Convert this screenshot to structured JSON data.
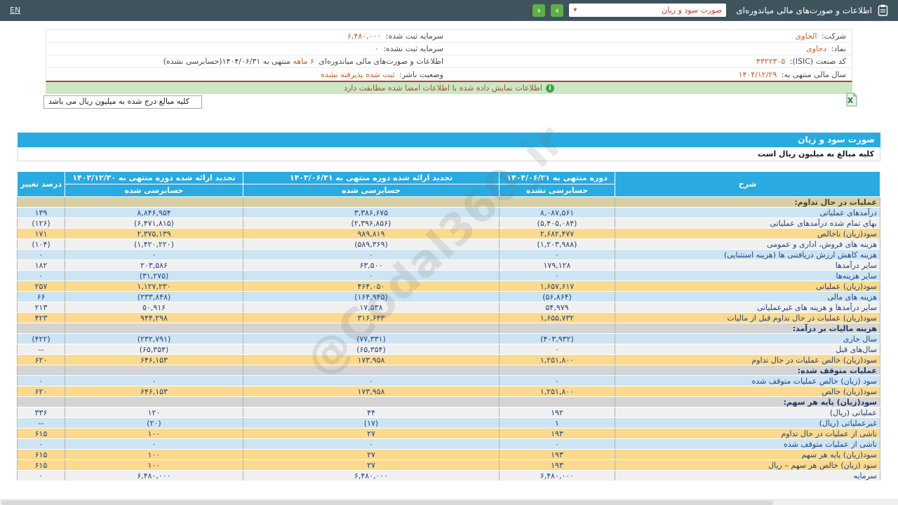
{
  "topbar": {
    "en_label": "EN",
    "title": "اطلاعات و صورت‌های مالی میاندوره‌ای",
    "dropdown_value": "صورت سود و زیان",
    "prev_icon": "‹",
    "next_icon": "›",
    "caret_icon": "▾"
  },
  "info_panel": {
    "rows": [
      {
        "right_label": "شرکت:",
        "right_value": "الحاوی",
        "left_label": "سرمایه ثبت شده:",
        "left_value": "۶,۴۸۰,۰۰۰"
      },
      {
        "right_label": "نماد:",
        "right_value": "دحاوی",
        "left_label": "سرمایه ثبت نشده:",
        "left_value": "۰"
      },
      {
        "right_label": "کد صنعت (ISIC):",
        "right_value": "۴۳۲۲۳۰۵",
        "left_prefix": "اطلاعات و صورت‌های مالی میاندوره‌ای ",
        "left_highlight": "۶ ماهه",
        "left_suffix": " منتهی به ۱۴۰۴/۰۶/۳۱(حسابرسی نشده)"
      },
      {
        "right_label": "سال مالی منتهی به:",
        "right_value": "۱۴۰۴/۱۲/۲۹",
        "left_label": "وضعیت ناشر:",
        "left_value": "ثبت شده پذیرفته نشده"
      }
    ]
  },
  "alert": {
    "icon": "i",
    "text": "اطلاعات نمایش داده شده با اطلاعات امضا شده مطابقت دارد"
  },
  "unit_box_text": "کلیه مبالغ درج شده به میلیون ریال می باشد",
  "statement": {
    "title": "صورت سود و زیان",
    "unit_note": "کلیه مبالغ به میلیون ریال است"
  },
  "table": {
    "header": {
      "desc": "شرح",
      "pct": "درصد تغییر",
      "cols": [
        {
          "period": "دوره منتهی به ۱۴۰۴/۰۶/۳۱",
          "audit": "حسابرسی نشده"
        },
        {
          "period": "تجدید ارائه شده دوره منتهی به ۱۴۰۳/۰۶/۳۱",
          "audit": "حسابرسی شده"
        },
        {
          "period": "تجدید ارائه شده دوره منتهی به ۱۴۰۳/۱۲/۳۰",
          "audit": "حسابرسی شده"
        }
      ]
    },
    "rows": [
      {
        "label": "عملیات در حال تداوم:",
        "v1": "",
        "v2": "",
        "v3": "",
        "pct": "",
        "style": "section-khaki"
      },
      {
        "label": "درآمدهای عملیاتی",
        "v1": "۸,۰۸۷,۵۶۱",
        "v2": "۳,۳۸۶,۶۷۵",
        "v3": "۸,۸۴۶,۹۵۴",
        "pct": "۱۳۹",
        "style": "blue"
      },
      {
        "label": "بهای تمام شده درآمدهای عملیاتی",
        "v1": "(۵,۴۰۵,۰۸۴)",
        "v2": "(۲,۳۹۶,۸۵۶)",
        "v3": "(۶,۴۷۱,۸۱۵)",
        "pct": "(۱۲۶)",
        "style": "white"
      },
      {
        "label": "سود(زیان) ناخالص",
        "v1": "۲,۶۸۲,۴۷۷",
        "v2": "۹۸۹,۸۱۹",
        "v3": "۲,۳۷۵,۱۳۹",
        "pct": "۱۷۱",
        "style": "yellow"
      },
      {
        "label": "هزینه های فروش، اداری و عمومی",
        "v1": "(۱,۲۰۳,۹۸۸)",
        "v2": "(۵۸۹,۳۶۹)",
        "v3": "(۱,۴۲۰,۲۲۰)",
        "pct": "(۱۰۴)",
        "style": "white"
      },
      {
        "label": "هزینه کاهش ارزش دریافتنی ها (هزینه استثنایی)",
        "v1": "۰",
        "v2": "۰",
        "v3": "۰",
        "pct": "۰",
        "style": "blue"
      },
      {
        "label": "سایر درآمدها",
        "v1": "۱۷۹,۱۲۸",
        "v2": "۶۳,۵۰۰",
        "v3": "۲۰۳,۵۸۶",
        "pct": "۱۸۲",
        "style": "white"
      },
      {
        "label": "سایر هزینه‌ها",
        "v1": "۰",
        "v2": "۰",
        "v3": "(۳۱,۲۷۵)",
        "pct": "۰",
        "style": "blue"
      },
      {
        "label": "سود(زیان) عملیاتی",
        "v1": "۱,۶۵۷,۶۱۷",
        "v2": "۴۶۴,۰۵۰",
        "v3": "۱,۱۲۷,۲۳۰",
        "pct": "۲۵۷",
        "style": "yellow"
      },
      {
        "label": "هزینه های مالی",
        "v1": "(۵۶,۸۶۴)",
        "v2": "(۱۶۴,۹۴۵)",
        "v3": "(۲۳۳,۸۴۸)",
        "pct": "۶۶",
        "style": "blue"
      },
      {
        "label": "سایر درآمدها و هزینه های غیرعملیاتی",
        "v1": "۵۴,۹۷۹",
        "v2": "۱۷,۵۳۸",
        "v3": "۵۰,۹۱۶",
        "pct": "۲۱۳",
        "style": "white"
      },
      {
        "label": "سود(زیان) عملیات در حال تداوم قبل از مالیات",
        "v1": "۱,۶۵۵,۷۳۲",
        "v2": "۳۱۶,۶۴۳",
        "v3": "۹۴۴,۲۹۸",
        "pct": "۴۲۳",
        "style": "yellow"
      },
      {
        "label": "هزینه مالیات بر درآمد:",
        "v1": "",
        "v2": "",
        "v3": "",
        "pct": "",
        "style": "section-gray"
      },
      {
        "label": "سال جاری",
        "v1": "(۴۰۳,۹۳۲)",
        "v2": "(۷۷,۳۳۱)",
        "v3": "(۲۳۲,۷۹۱)",
        "pct": "(۴۲۲)",
        "style": "blue"
      },
      {
        "label": "سال‌های قبل",
        "v1": "۰",
        "v2": "(۶۵,۳۵۴)",
        "v3": "(۶۵,۳۵۴)",
        "pct": "--",
        "style": "white"
      },
      {
        "label": "سود(زیان) خالص عملیات در حال تداوم",
        "v1": "۱,۲۵۱,۸۰۰",
        "v2": "۱۷۳,۹۵۸",
        "v3": "۶۴۶,۱۵۳",
        "pct": "۶۲۰",
        "style": "yellow"
      },
      {
        "label": "عملیات متوقف شده:",
        "v1": "",
        "v2": "",
        "v3": "",
        "pct": "",
        "style": "section-gray"
      },
      {
        "label": "سود (زیان) خالص عملیات متوقف شده",
        "v1": "۰",
        "v2": "۰",
        "v3": "۰",
        "pct": "۰",
        "style": "blue"
      },
      {
        "label": "سود(زیان) خالص",
        "v1": "۱,۲۵۱,۸۰۰",
        "v2": "۱۷۳,۹۵۸",
        "v3": "۶۴۶,۱۵۳",
        "pct": "۶۲۰",
        "style": "yellow"
      },
      {
        "label": "سود(زیان) پایه هر سهم:",
        "v1": "",
        "v2": "",
        "v3": "",
        "pct": "",
        "style": "section-gray"
      },
      {
        "label": "عملیاتی (ریال)",
        "v1": "۱۹۲",
        "v2": "۴۴",
        "v3": "۱۲۰",
        "pct": "۳۳۶",
        "style": "white"
      },
      {
        "label": "غیرعملیاتی (ریال)",
        "v1": "۱",
        "v2": "(۱۷)",
        "v3": "(۲۰)",
        "pct": "--",
        "style": "blue"
      },
      {
        "label": "ناشی از عملیات در حال تداوم",
        "v1": "۱۹۳",
        "v2": "۲۷",
        "v3": "۱۰۰",
        "pct": "۶۱۵",
        "style": "yellow"
      },
      {
        "label": "ناشی از عملیات متوقف شده",
        "v1": "۰",
        "v2": "۰",
        "v3": "۰",
        "pct": "۰",
        "style": "blue"
      },
      {
        "label": "سود(زیان) پایه هر سهم",
        "v1": "۱۹۳",
        "v2": "۲۷",
        "v3": "۱۰۰",
        "pct": "۶۱۵",
        "style": "yellow"
      },
      {
        "label": "سود (زیان) خالص هر سهم – ریال",
        "v1": "۱۹۳",
        "v2": "۲۷",
        "v3": "۱۰۰",
        "pct": "۶۱۵",
        "style": "yellow"
      },
      {
        "label": "سرمایه",
        "v1": "۶,۴۸۰,۰۰۰",
        "v2": "۶,۴۸۰,۰۰۰",
        "v3": "۶,۴۸۰,۰۰۰",
        "pct": "۰",
        "style": "white"
      }
    ]
  },
  "watermark": "@Codal360_ir",
  "colors": {
    "topbar_bg": "#3e535c",
    "accent_blue": "#29abe2",
    "row_blue": "#cde4f3",
    "row_yellow": "#fbd98d",
    "section_khaki": "#d8d0a4",
    "section_gray": "#d4d4d4",
    "negative_red": "#e02222",
    "link_orange": "#cf5c22",
    "alert_green_bg": "#cbe7c4",
    "nav_button_green": "#5cb046"
  }
}
